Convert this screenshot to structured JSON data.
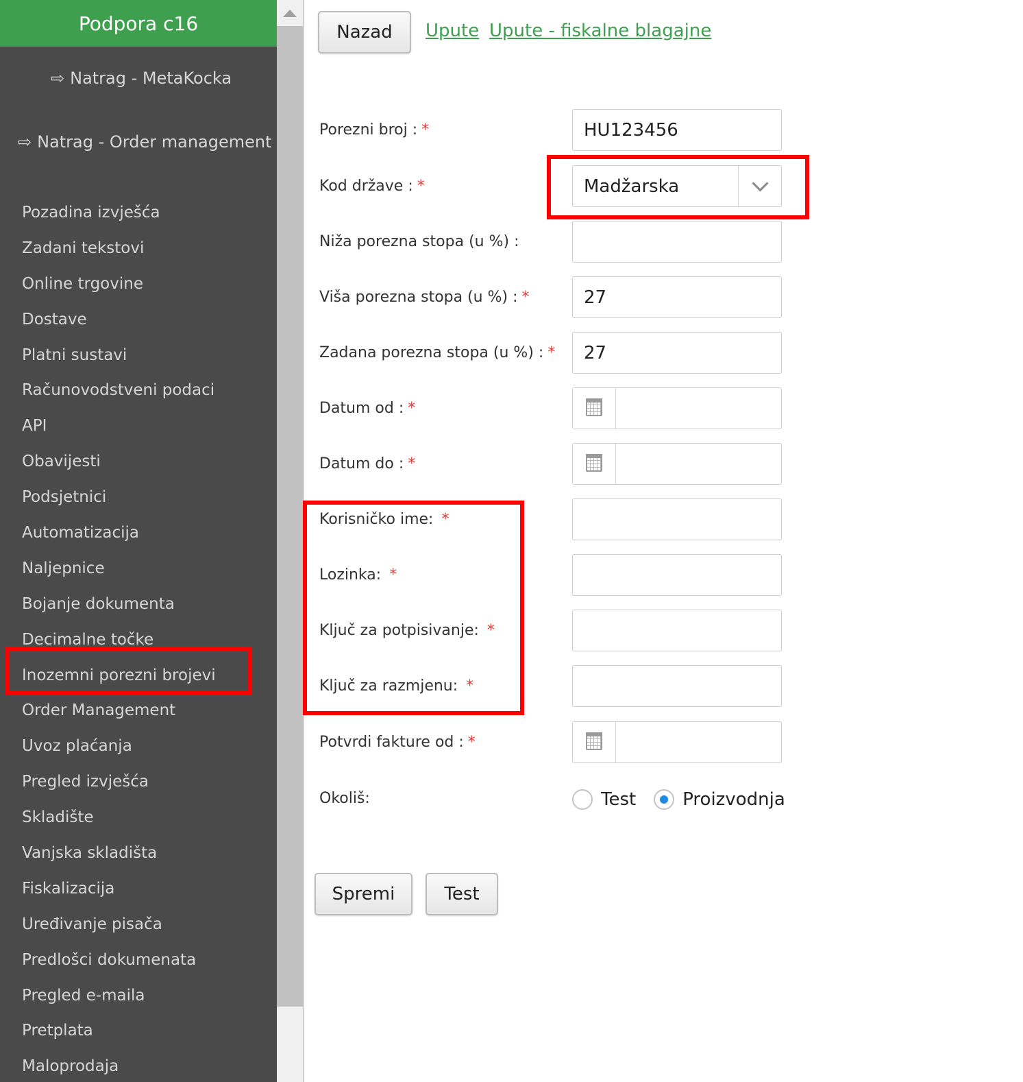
{
  "sidebar": {
    "title": "Podpora c16",
    "back_links": [
      {
        "label": "Natrag - MetaKocka",
        "icon": "exit-icon"
      },
      {
        "label": "Natrag - Order management",
        "icon": "exit-icon"
      }
    ],
    "items": [
      {
        "label": "Pozadina izvješća"
      },
      {
        "label": "Zadani tekstovi"
      },
      {
        "label": "Online trgovine"
      },
      {
        "label": "Dostave"
      },
      {
        "label": "Platni sustavi"
      },
      {
        "label": "Računovodstveni podaci"
      },
      {
        "label": "API"
      },
      {
        "label": "Obavijesti"
      },
      {
        "label": "Podsjetnici"
      },
      {
        "label": "Automatizacija"
      },
      {
        "label": "Naljepnice"
      },
      {
        "label": "Bojanje dokumenta"
      },
      {
        "label": "Decimalne točke"
      },
      {
        "label": "Inozemni porezni brojevi"
      },
      {
        "label": "Order Management"
      },
      {
        "label": "Uvoz plaćanja"
      },
      {
        "label": "Pregled izvješća"
      },
      {
        "label": "Skladište"
      },
      {
        "label": "Vanjska skladišta"
      },
      {
        "label": "Fiskalizacija"
      },
      {
        "label": "Uređivanje pisača"
      },
      {
        "label": "Predlošci dokumenata"
      },
      {
        "label": "Pregled e-maila"
      },
      {
        "label": "Pretplata"
      },
      {
        "label": "Maloprodaja"
      }
    ]
  },
  "toolbar": {
    "back_label": "Nazad",
    "link_1": "Upute",
    "link_2": "Upute - fiskalne blagajne"
  },
  "form": {
    "tax_number": {
      "label": "Porezni broj :",
      "value": "HU123456",
      "required": true
    },
    "country_code": {
      "label": "Kod države :",
      "value": "Madžarska",
      "required": true
    },
    "lower_rate": {
      "label": "Niža porezna stopa (u %) :",
      "value": "",
      "required": false
    },
    "higher_rate": {
      "label": "Viša porezna stopa (u %) :",
      "value": "27",
      "required": true
    },
    "default_rate": {
      "label": "Zadana porezna stopa (u %) :",
      "value": "27",
      "required": true
    },
    "date_from": {
      "label": "Datum od :",
      "value": "",
      "required": true
    },
    "date_to": {
      "label": "Datum do :",
      "value": "",
      "required": true
    },
    "username": {
      "label": "Korisničko ime:",
      "value": "",
      "required": true
    },
    "password": {
      "label": "Lozinka:",
      "value": "",
      "required": true
    },
    "signing_key": {
      "label": "Ključ za potpisivanje:",
      "value": "",
      "required": true
    },
    "exchange_key": {
      "label": "Ključ za razmjenu:",
      "value": "",
      "required": true
    },
    "confirm_invoices_from": {
      "label": "Potvrdi fakture od :",
      "value": "",
      "required": true
    },
    "environment": {
      "label": "Okoliš:",
      "options": [
        "Test",
        "Proizvodnja"
      ],
      "selected": "Proizvodnja"
    },
    "required_mark": "*"
  },
  "actions": {
    "save_label": "Spremi",
    "test_label": "Test"
  },
  "colors": {
    "brand_green": "#3ea04f",
    "sidebar_bg": "#4a4a4a",
    "highlight_red": "#ff0000",
    "required_red": "#e53935",
    "radio_blue": "#1e88e5"
  }
}
